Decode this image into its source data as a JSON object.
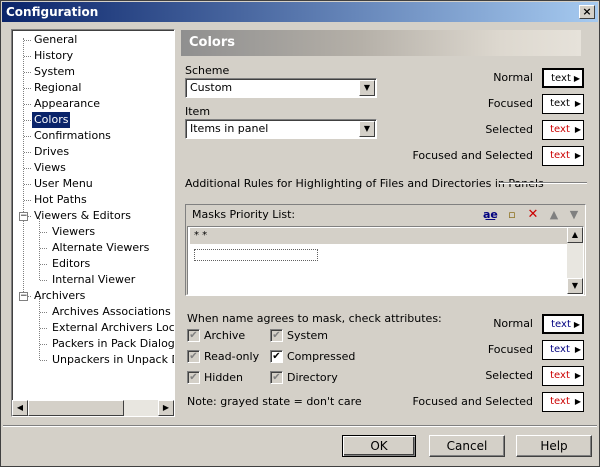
{
  "window": {
    "title": "Configuration",
    "close_glyph": "×"
  },
  "tree": {
    "items": [
      {
        "label": "General"
      },
      {
        "label": "History"
      },
      {
        "label": "System"
      },
      {
        "label": "Regional"
      },
      {
        "label": "Appearance"
      },
      {
        "label": "Colors",
        "selected": true
      },
      {
        "label": "Confirmations"
      },
      {
        "label": "Drives"
      },
      {
        "label": "Views"
      },
      {
        "label": "User Menu"
      },
      {
        "label": "Hot Paths"
      },
      {
        "label": "Viewers & Editors",
        "expanded": true
      },
      {
        "label": "Viewers"
      },
      {
        "label": "Alternate Viewers"
      },
      {
        "label": "Editors"
      },
      {
        "label": "Internal Viewer"
      },
      {
        "label": "Archivers",
        "expanded": true
      },
      {
        "label": "Archives Associations in P"
      },
      {
        "label": "External Archivers Locatio"
      },
      {
        "label": "Packers in Pack Dialog B"
      },
      {
        "label": "Unpackers in Unpack Dia"
      }
    ],
    "expander_glyph": "−"
  },
  "colors": {
    "header": "Colors",
    "scheme_label": "Scheme",
    "scheme_value": "Custom",
    "item_label": "Item",
    "item_value": "Items in panel",
    "states_top": [
      {
        "label": "Normal",
        "text_color": "#000000"
      },
      {
        "label": "Focused",
        "text_color": "#000000"
      },
      {
        "label": "Selected",
        "text_color": "#cc0000"
      },
      {
        "label": "Focused and Selected",
        "text_color": "#cc0000"
      }
    ],
    "swatch_text": "text",
    "rules_title": "Additional Rules for Highlighting of Files and Directories in Panels",
    "masks_label": "Masks Priority List:",
    "masks_row": "* *",
    "attrs_label": "When name agrees to mask, check attributes:",
    "attrs": [
      {
        "label": "Archive",
        "state": "grayed"
      },
      {
        "label": "System",
        "state": "grayed"
      },
      {
        "label": "Read-only",
        "state": "grayed"
      },
      {
        "label": "Compressed",
        "state": "checked"
      },
      {
        "label": "Hidden",
        "state": "grayed"
      },
      {
        "label": "Directory",
        "state": "grayed"
      }
    ],
    "note": "Note: grayed state = don't care",
    "states_bottom": [
      {
        "label": "Normal",
        "text_color": "#000080"
      },
      {
        "label": "Focused",
        "text_color": "#000080"
      },
      {
        "label": "Selected",
        "text_color": "#cc0000"
      },
      {
        "label": "Focused and Selected",
        "text_color": "#cc0000"
      }
    ]
  },
  "buttons": {
    "ok": "OK",
    "cancel": "Cancel",
    "help": "Help"
  },
  "accent": {
    "title_start": "#0a246a",
    "selection": "#0a246a"
  }
}
